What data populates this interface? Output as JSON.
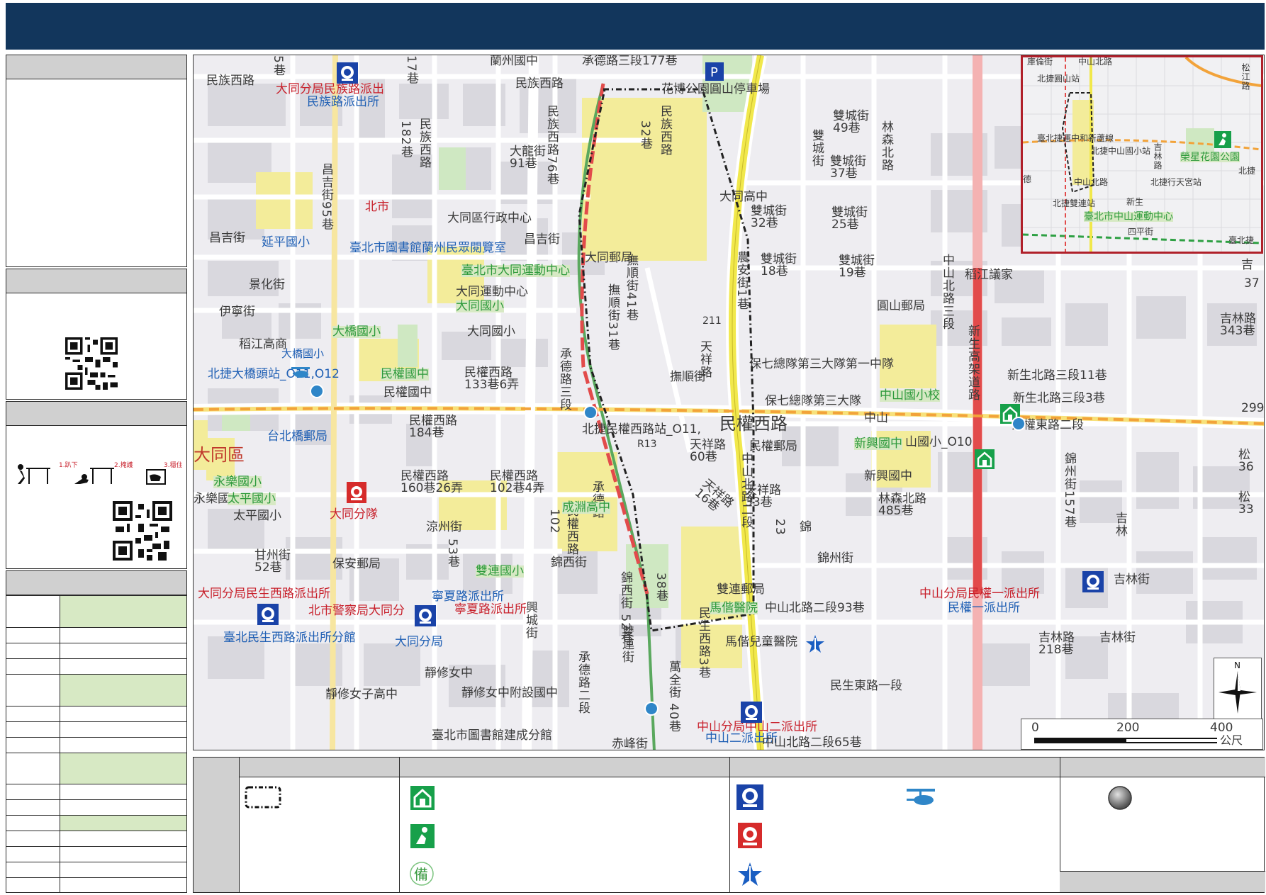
{
  "map_labels": {
    "minzu_w_rd": "民族西路",
    "datong_minzu": "大同分局民族路派出",
    "minzu_station": "民族路派出所",
    "lanzhou": "蘭州國中",
    "chengde3_177": "承德路三段177巷",
    "minzu_w_rd2": "民族西路",
    "lane17": "17巷",
    "lane5": "5巷",
    "lane182": "182巷",
    "minzu_w_v": "民族西路",
    "minzu_w76": "民族西路76巷",
    "dalong91": "大龍街 91巷",
    "huabo_park": "花博公園圓山停車場",
    "lane32": "32巷",
    "minzu_w_rd_v": "民族西路",
    "datong_hs": "大同高中",
    "changji95": "昌吉街95巷",
    "beishi": "北市",
    "datong_admin": "大同區行政中心",
    "changji_st": "昌吉街",
    "yanping": "延平國小",
    "library": "臺北市圖書館蘭州民眾閱覽室",
    "changji_st2": "昌吉街",
    "datong_sports": "臺北市大同運動中心",
    "datong_post": "大同郵局",
    "datong_activity": "大同運動中心",
    "datong_es_bei": "大同國小",
    "datong_es": "大同國小",
    "jingshi_ave": "景化街",
    "yining": "伊寧街",
    "daojiang": "稻江高商",
    "daqiao_es_bei": "大橋國小",
    "daqiao_es": "大橋國小",
    "daqiao_station": "北捷大橋頭站_O11,O12",
    "minquan_jhs_bei": "民權國中",
    "minquan_jhs": "民權國中",
    "minquan_w_133": "民權西路 133巷6弄",
    "fushun41": "撫順街41巷",
    "fushun31": "撫順街31巷",
    "fushun_st": "撫順街",
    "tianxiang_v": "天祥路",
    "chengde3": "承德路三段",
    "minquan_w_station": "北捷民權西路站_O11,",
    "minquan_w_rd": "民權西路",
    "r13": "R13",
    "tianxiang60": "天祥路 60巷",
    "minquan_post": "民權郵局",
    "taipei_bridge_post": "台北橋郵局",
    "datong_district": "大同區",
    "minquan_w184": "民權西路 184巷",
    "minquan_w160": "民權西路 160巷26弄",
    "minquan_w102": "民權西路 102巷4弄",
    "v102": "102",
    "minquan_w_v": "民權西路",
    "chengde_v": "承德路",
    "yongle_bei": "永樂國小",
    "yongle": "永樂國",
    "taiping_bei": "太平國小",
    "taiping": "太平國小",
    "datong_fire": "大同分隊",
    "liangzhou": "涼州街",
    "lane53": "53巷",
    "chengyuan_bei": "成淵高中",
    "tianxiang16": "天祥路 16巷",
    "tianxiang33": "天祥路 33巷",
    "ganzhou52": "甘州街 52巷",
    "baoan_post": "保安郵局",
    "jinxi": "錦西街",
    "jinxi52": "錦西街 52巷",
    "lane38": "38巷",
    "shuanglian_bei": "雙連國小",
    "minsheng_w_station": "大同分局民生西路派出所",
    "police_datong": "北市警察局大同分",
    "ningxia_station": "寧夏路派出所",
    "ningxia_station2": "寧夏路派出所",
    "minsheng_branch": "臺北民生西路派出所分館",
    "datong_branch": "大同分局",
    "xingcheng": "興城街",
    "chengde2": "承德路二段",
    "shuanglian_st": "雙連街",
    "wanquan40": "萬全街 40巷",
    "jingxiu_girls": "靜修女中",
    "jingxiu_girls_hs": "靜修女子高中",
    "jingxiu_affiliate": "靜修女中附設國中",
    "jiancheng_library": "臺北市圖書館建成分館",
    "chishui": "赤峰街",
    "zhongshan_n2": "中山北路二段",
    "shuangcheng49": "雙城街 49巷",
    "shuangcheng_v": "雙城街",
    "shuangcheng37": "雙城街 37巷",
    "linsen_n": "林森北路",
    "shuangcheng32": "雙城街 32巷",
    "shuangcheng25": "雙城街 25巷",
    "shuangcheng18": "雙城街 18巷",
    "shuangcheng19": "雙城街 19巷",
    "nongan1": "農安街1巷",
    "yuanshan_post": "圓山郵局",
    "baoqi_1": "保七總隊第三大隊第一中隊",
    "baoqi_3": "保七總隊第三大隊",
    "n211": "211",
    "zhongshan_es": "中山國小校",
    "zhongshan_n": "中山北路二段",
    "zhongshan_s": "中山",
    "xinxing_jhs_bei": "新興國中",
    "zhongshan_es_o10": "山國小_O10",
    "xinxing_jhs": "新興國中",
    "linsen485": "林森北路 485巷",
    "jin_st": "錦",
    "jinzhou": "錦州街",
    "lane_z3": "23",
    "shuanglian_post": "雙連郵局",
    "mackay": "馬偕醫院",
    "mackay_child": "馬偕兒童醫院",
    "minsheng_w3": "民生西路3巷",
    "zhongshan_n93": "中山北路二段93巷",
    "minsheng_e1": "民生東路一段",
    "zhongshan2_station": "中山分局中山二派出所",
    "zhongshan2_station2": "中山二派出所",
    "zhongshan_n65": "中山北路二段65巷",
    "minquan1_station": "中山分局民權一派出所",
    "minquan1_station2": "民權一派出所",
    "jilin218": "吉林路 218巷",
    "jilin_st": "吉林街",
    "jilin_st2": "吉林街",
    "xinsheng3_11": "新生北路三段11巷",
    "xinsheng3_3": "新生北路三段3巷",
    "minquan_e2": "民權東路二段",
    "xinsheng_elevated": "新生高架道路",
    "zhongshan_n3": "中山北路三段",
    "jinzhou157": "錦州街157巷",
    "daojiang_council": "稻江議家",
    "jilin343": "吉林路 343巷",
    "n299": "299",
    "n37": "37",
    "song36": "松 36",
    "song33": "松 33",
    "jilin_v": "吉林",
    "ji": "吉"
  },
  "inset_labels": {
    "kulun": "庫倫街",
    "zhongshan_n": "中山北路",
    "yuanshan": "北捷圓山站",
    "songjiang": "松江路",
    "mrt_line": "臺北捷運中和新蘆線",
    "zhongshan_es": "北捷中山國小站",
    "jilin": "吉林路",
    "rongxing": "榮星花園公園",
    "beijie": "北捷",
    "minquan": "中山北路",
    "xingtian": "北捷行天宮站",
    "shuanglian": "北捷雙連站",
    "xinsheng": "新生",
    "sports": "臺北市中山運動中心",
    "beiji": "臺北捷",
    "siping": "四平街",
    "de": "德"
  },
  "scale": {
    "zero": "0",
    "mid": "200",
    "max": "400",
    "unit": "公尺",
    "north": "N"
  },
  "colors": {
    "title_bar": "#12365c",
    "route_dash": "#222222",
    "highway": "#f1e84b",
    "mrt": "#f2a33a",
    "rail_red": "#e24b4b",
    "green_row": "#d7e9c4"
  },
  "icons": [
    "police-badge-icon",
    "fire-station-icon",
    "hospital-icon",
    "shelter-icon",
    "evacuation-park-icon",
    "standby-shelter-icon",
    "helicopter-icon",
    "parking-icon",
    "mrt-station-icon",
    "qr-code-icon",
    "earthquake-drill-icon",
    "compass-icon",
    "gray-circle-icon"
  ],
  "drill": {
    "step1": "1.趴下",
    "step2": "2.掩護",
    "step3": "3.穩住"
  }
}
